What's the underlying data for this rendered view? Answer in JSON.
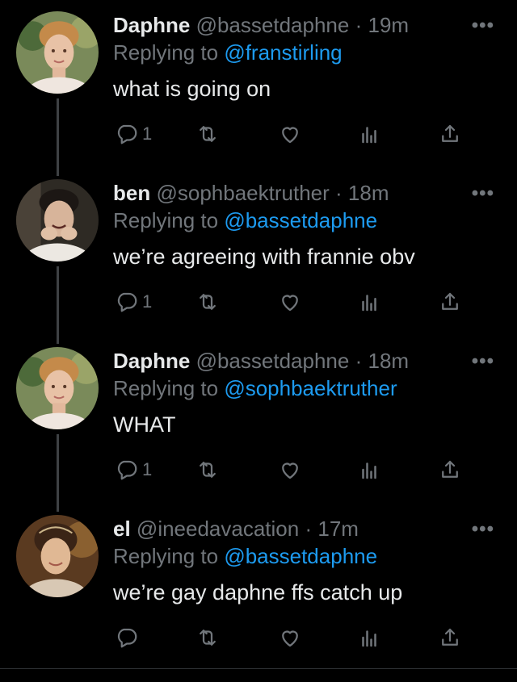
{
  "colors": {
    "background": "#000000",
    "text": "#e7e9ea",
    "muted": "#71767b",
    "link": "#1d9bf0"
  },
  "tweets": [
    {
      "name": "Daphne",
      "handle": "@bassetdaphne",
      "separator": "·",
      "time": "19m",
      "reply_prefix": "Replying to",
      "reply_to": "@franstirling",
      "text": "what is going on",
      "reply_count": "1",
      "more_icon": "ellipsis-icon"
    },
    {
      "name": "ben",
      "handle": "@sophbaektruther",
      "separator": "·",
      "time": "18m",
      "reply_prefix": "Replying to",
      "reply_to": "@bassetdaphne",
      "text": "we’re agreeing with frannie obv",
      "reply_count": "1",
      "more_icon": "ellipsis-icon"
    },
    {
      "name": "Daphne",
      "handle": "@bassetdaphne",
      "separator": "·",
      "time": "18m",
      "reply_prefix": "Replying to",
      "reply_to": "@sophbaektruther",
      "text": "WHAT",
      "reply_count": "1",
      "more_icon": "ellipsis-icon"
    },
    {
      "name": "el",
      "handle": "@ineedavacation",
      "separator": "·",
      "time": "17m",
      "reply_prefix": "Replying to",
      "reply_to": "@bassetdaphne",
      "text": "we’re gay daphne ffs catch up",
      "reply_count": "",
      "more_icon": "ellipsis-icon"
    }
  ]
}
